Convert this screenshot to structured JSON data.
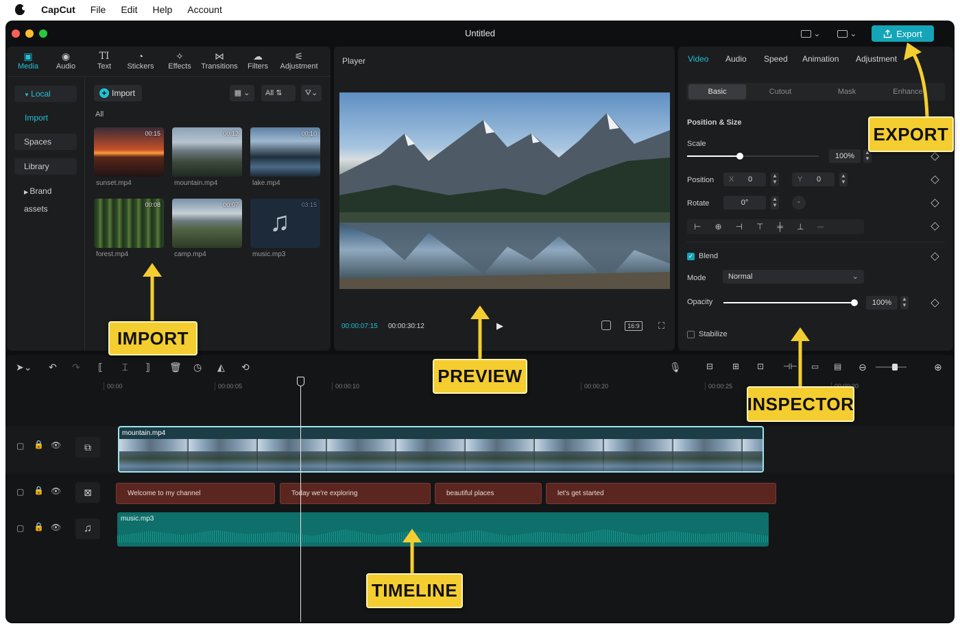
{
  "menubar": {
    "app": "CapCut",
    "items": [
      "File",
      "Edit",
      "Help",
      "Account"
    ]
  },
  "window": {
    "title": "Untitled",
    "export_label": "Export"
  },
  "media_tabs": [
    {
      "label": "Media",
      "icon": "media-icon",
      "active": true
    },
    {
      "label": "Audio",
      "icon": "audio-icon"
    },
    {
      "label": "Text",
      "icon": "text-icon"
    },
    {
      "label": "Stickers",
      "icon": "stickers-icon"
    },
    {
      "label": "Effects",
      "icon": "effects-icon"
    },
    {
      "label": "Transitions",
      "icon": "transitions-icon"
    },
    {
      "label": "Filters",
      "icon": "filters-icon"
    },
    {
      "label": "Adjustment",
      "icon": "adjustment-icon"
    }
  ],
  "sidebar": {
    "local": "Local",
    "import": "Import",
    "spaces": "Spaces",
    "library": "Library",
    "brand": "Brand assets"
  },
  "media_toolbar": {
    "import": "Import",
    "all": "All",
    "section": "All"
  },
  "thumbs": [
    {
      "name": "sunset.mp4",
      "duration": "00:15"
    },
    {
      "name": "mountain.mp4",
      "duration": "00:12"
    },
    {
      "name": "lake.mp4",
      "duration": "00:10"
    },
    {
      "name": "forest.mp4",
      "duration": "00:08"
    },
    {
      "name": "camp.mp4",
      "duration": "00:07"
    },
    {
      "name": "music.mp3",
      "duration": "03:15"
    }
  ],
  "player": {
    "title": "Player",
    "current": "00:00:07:15",
    "total": "00:00:30:12",
    "ratio": "16:9"
  },
  "inspector": {
    "tabs": [
      "Video",
      "Audio",
      "Speed",
      "Animation",
      "Adjustment"
    ],
    "subtabs": [
      "Basic",
      "Cutout",
      "Mask",
      "Enhance"
    ],
    "section": "Position & Size",
    "scale_label": "Scale",
    "scale_value": "100%",
    "scale_fraction": 0.4,
    "position_label": "Position",
    "x_label": "X",
    "x_value": "0",
    "y_label": "Y",
    "y_value": "0",
    "rotate_label": "Rotate",
    "rotate_value": "0°",
    "blend_label": "Blend",
    "mode_label": "Mode",
    "mode_value": "Normal",
    "opacity_label": "Opacity",
    "opacity_value": "100%",
    "opacity_fraction": 1.0,
    "stabilize_label": "Stabilize"
  },
  "timeline": {
    "ticks": [
      "00:00",
      "00:00:05",
      "00:00:10",
      "00:00:20",
      "00:00:25",
      "00:00:30"
    ],
    "video_clip": "mountain.mp4",
    "text_clips": [
      "Welcome to my channel",
      "Today we're exploring",
      "beautiful places",
      "let's get started"
    ],
    "audio_clip": "music.mp3"
  },
  "callouts": {
    "import": "IMPORT",
    "preview": "PREVIEW",
    "inspector": "INSPECTOR",
    "timeline": "TIMELINE",
    "export": "EXPORT"
  },
  "colors": {
    "accent": "#14a5b8",
    "callout": "#f4cd30",
    "text_clip": "#5b2620",
    "audio_clip": "#0f6f6a"
  }
}
